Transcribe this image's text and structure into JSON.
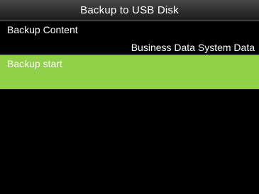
{
  "window": {
    "title": "Backup to USB Disk"
  },
  "menu": {
    "backup_content": {
      "label": "Backup Content",
      "value": "Business Data System Data"
    },
    "backup_start": {
      "label": "Backup start",
      "selected": true
    }
  },
  "colors": {
    "highlight": "#91d149",
    "background": "#000000",
    "text": "#ffffff"
  }
}
